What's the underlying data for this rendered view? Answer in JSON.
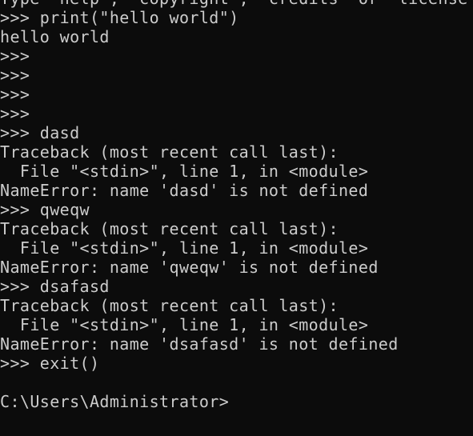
{
  "console": {
    "lines": [
      "Type \"help\", \"copyright\", \"credits\" or \"license\" for more information.",
      ">>> print(\"hello world\")",
      "hello world",
      ">>>",
      ">>>",
      ">>>",
      ">>>",
      ">>> dasd",
      "Traceback (most recent call last):",
      "  File \"<stdin>\", line 1, in <module>",
      "NameError: name 'dasd' is not defined",
      ">>> qweqw",
      "Traceback (most recent call last):",
      "  File \"<stdin>\", line 1, in <module>",
      "NameError: name 'qweqw' is not defined",
      ">>> dsafasd",
      "Traceback (most recent call last):",
      "  File \"<stdin>\", line 1, in <module>",
      "NameError: name 'dsafasd' is not defined",
      ">>> exit()",
      "",
      "C:\\Users\\Administrator>"
    ]
  }
}
